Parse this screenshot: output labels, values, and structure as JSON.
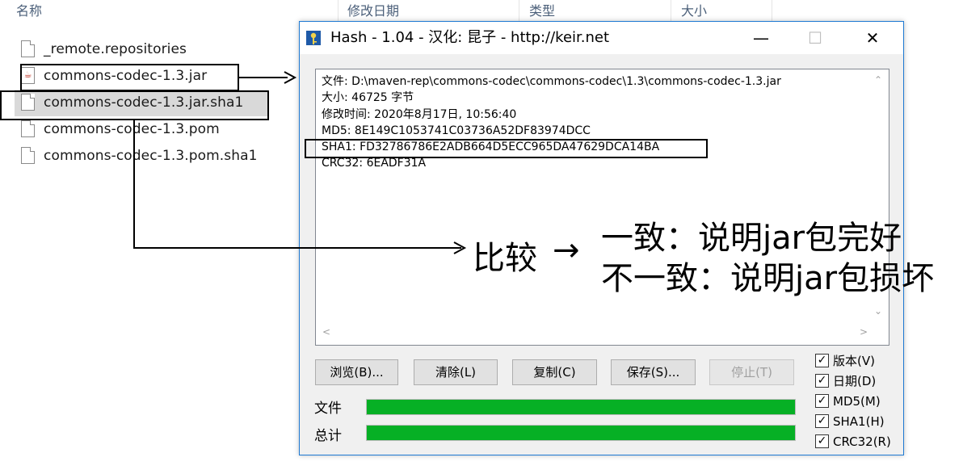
{
  "explorer": {
    "columns": {
      "name": "名称",
      "modified": "修改日期",
      "type": "类型",
      "size": "大小"
    },
    "files": [
      {
        "name": "_remote.repositories",
        "icon": "file-icon"
      },
      {
        "name": "commons-codec-1.3.jar",
        "icon": "java-jar-icon"
      },
      {
        "name": "commons-codec-1.3.jar.sha1",
        "icon": "file-icon"
      },
      {
        "name": "commons-codec-1.3.pom",
        "icon": "file-icon"
      },
      {
        "name": "commons-codec-1.3.pom.sha1",
        "icon": "file-icon"
      }
    ],
    "selected_index": 2
  },
  "hash_window": {
    "title": "Hash - 1.04 - 汉化: 昆子 - http://keir.net",
    "controls": {
      "minimize": "—",
      "maximize": "☐",
      "close": "✕"
    },
    "output_lines": [
      "文件: D:\\maven-rep\\commons-codec\\commons-codec\\1.3\\commons-codec-1.3.jar",
      "大小: 46725 字节",
      "修改时间: 2020年8月17日, 10:56:40",
      "MD5: 8E149C1053741C03736A52DF83974DCC",
      "SHA1: FD32786786E2ADB664D5ECC965DA47629DCA14BA",
      "CRC32: 6EADF31A"
    ],
    "buttons": {
      "browse": "浏览(B)...",
      "clear": "清除(L)",
      "copy": "复制(C)",
      "save": "保存(S)...",
      "stop": "停止(T)"
    },
    "progress": [
      {
        "label": "文件",
        "value": 1.0
      },
      {
        "label": "总计",
        "value": 1.0
      }
    ],
    "options": [
      {
        "label": "版本(V)",
        "checked": true
      },
      {
        "label": "日期(D)",
        "checked": true
      },
      {
        "label": "MD5(M)",
        "checked": true
      },
      {
        "label": "SHA1(H)",
        "checked": true
      },
      {
        "label": "CRC32(R)",
        "checked": true
      }
    ],
    "progress_color": "#06b025"
  },
  "annotation": {
    "compare": "比较",
    "arrow": "→",
    "same": "一致：说明jar包完好",
    "different": "不一致：说明jar包损坏"
  }
}
